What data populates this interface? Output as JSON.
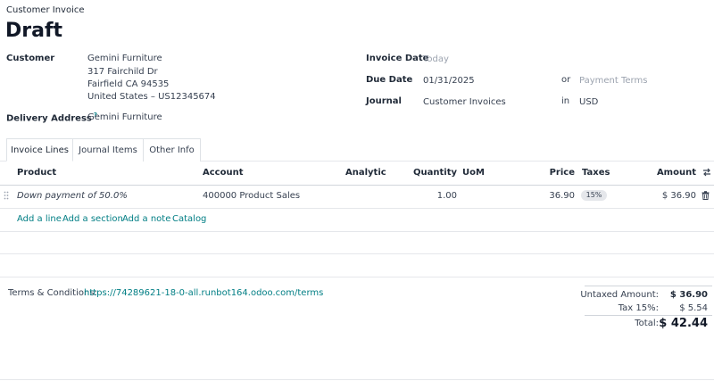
{
  "header": {
    "breadcrumb": "Customer Invoice",
    "status_title": "Draft"
  },
  "customer": {
    "label": "Customer",
    "name": "Gemini Furniture",
    "address_line1": "317 Fairchild Dr",
    "address_line2": "Fairfield CA 94535",
    "address_line3": "United States – US12345674"
  },
  "delivery": {
    "label": "Delivery Address",
    "help": "?",
    "value": "Gemini Furniture"
  },
  "invoice_date": {
    "label": "Invoice Date",
    "placeholder": "Today"
  },
  "due_date": {
    "label": "Due Date",
    "value": "01/31/2025",
    "or": "or",
    "terms_placeholder": "Payment Terms"
  },
  "journal": {
    "label": "Journal",
    "value": "Customer Invoices",
    "in": "in",
    "currency": "USD"
  },
  "tabs": [
    {
      "label": "Invoice Lines",
      "active": true
    },
    {
      "label": "Journal Items",
      "active": false
    },
    {
      "label": "Other Info",
      "active": false
    }
  ],
  "table": {
    "headers": {
      "product": "Product",
      "account": "Account",
      "analytic": "Analytic",
      "quantity": "Quantity",
      "uom": "UoM",
      "price": "Price",
      "taxes": "Taxes",
      "amount": "Amount"
    },
    "rows": [
      {
        "product": "Down payment of 50.0%",
        "account": "400000 Product Sales",
        "quantity": "1.00",
        "price": "36.90",
        "tax": "15%",
        "amount": "$ 36.90"
      }
    ],
    "actions": {
      "add_line": "Add a line",
      "add_section": "Add a section",
      "add_note": "Add a note",
      "catalog": "Catalog"
    }
  },
  "terms": {
    "label": "Terms & Conditions:",
    "link": "https://74289621-18-0-all.runbot164.odoo.com/terms"
  },
  "totals": {
    "untaxed_label": "Untaxed Amount:",
    "untaxed_value": "$ 36.90",
    "tax_label": "Tax 15%:",
    "tax_value": "$ 5.54",
    "total_label": "Total:",
    "total_value": "$ 42.44"
  },
  "icons": [
    "drag-handle-icon",
    "trash-icon",
    "column-settings-icon"
  ]
}
